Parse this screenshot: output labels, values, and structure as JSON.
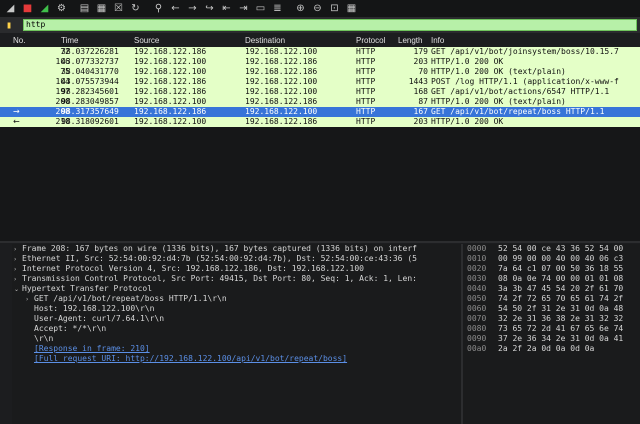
{
  "toolbar": {
    "icons": [
      "shark-fin-icon",
      "stop-capture-icon",
      "restart-capture-icon",
      "capture-options-icon",
      "open-file-icon",
      "save-file-icon",
      "close-file-icon",
      "reload-icon",
      "find-packet-icon",
      "go-back-icon",
      "go-forward-icon",
      "go-to-packet-icon",
      "first-packet-icon",
      "last-packet-icon",
      "autoscroll-icon",
      "colorize-icon",
      "zoom-in-icon",
      "zoom-out-icon",
      "normal-size-icon"
    ]
  },
  "filter": {
    "value": "http"
  },
  "columns": {
    "no": "No.",
    "time": "Time",
    "source": "Source",
    "destination": "Destination",
    "protocol": "Protocol",
    "length": "Length",
    "info": "Info"
  },
  "packets": [
    {
      "no": "72",
      "time": "38.037226281",
      "source": "192.168.122.186",
      "destination": "192.168.122.100",
      "protocol": "HTTP",
      "length": "179",
      "info": "GET /api/v1/bot/joinsystem/boss/10.15.7",
      "mark": ""
    },
    {
      "no": "106",
      "time": "43.077332737",
      "source": "192.168.122.100",
      "destination": "192.168.122.186",
      "protocol": "HTTP",
      "length": "203",
      "info": "HTTP/1.0 200 OK",
      "mark": ""
    },
    {
      "no": "75",
      "time": "38.040431770",
      "source": "192.168.122.100",
      "destination": "192.168.122.186",
      "protocol": "HTTP",
      "length": "70",
      "info": "HTTP/1.0 200 OK  (text/plain)",
      "mark": ""
    },
    {
      "no": "104",
      "time": "43.075573944",
      "source": "192.168.122.186",
      "destination": "192.168.122.100",
      "protocol": "HTTP",
      "length": "1443",
      "info": "POST /log HTTP/1.1  (application/x-www-f",
      "mark": ""
    },
    {
      "no": "197",
      "time": "98.282345601",
      "source": "192.168.122.186",
      "destination": "192.168.122.100",
      "protocol": "HTTP",
      "length": "168",
      "info": "GET /api/v1/bot/actions/6547 HTTP/1.1",
      "mark": ""
    },
    {
      "no": "200",
      "time": "98.283049857",
      "source": "192.168.122.100",
      "destination": "192.168.122.186",
      "protocol": "HTTP",
      "length": "87",
      "info": "HTTP/1.0 200 OK  (text/plain)",
      "mark": ""
    },
    {
      "no": "208",
      "time": "98.317357649",
      "source": "192.168.122.186",
      "destination": "192.168.122.100",
      "protocol": "HTTP",
      "length": "167",
      "info": "GET /api/v1/bot/repeat/boss HTTP/1.1",
      "mark": "→",
      "selected": true
    },
    {
      "no": "210",
      "time": "98.318092601",
      "source": "192.168.122.100",
      "destination": "192.168.122.186",
      "protocol": "HTTP",
      "length": "203",
      "info": "HTTP/1.0 200 OK",
      "mark": "←"
    }
  ],
  "details": [
    {
      "indent": 0,
      "tri": "›",
      "text": "Frame 208: 167 bytes on wire (1336 bits), 167 bytes captured (1336 bits) on interf"
    },
    {
      "indent": 0,
      "tri": "›",
      "text": "Ethernet II, Src: 52:54:00:92:d4:7b (52:54:00:92:d4:7b), Dst: 52:54:00:ce:43:36 (5"
    },
    {
      "indent": 0,
      "tri": "›",
      "text": "Internet Protocol Version 4, Src: 192.168.122.186, Dst: 192.168.122.100"
    },
    {
      "indent": 0,
      "tri": "›",
      "text": "Transmission Control Protocol, Src Port: 49415, Dst Port: 80, Seq: 1, Ack: 1, Len:"
    },
    {
      "indent": 0,
      "tri": "⌄",
      "text": "Hypertext Transfer Protocol"
    },
    {
      "indent": 1,
      "tri": "›",
      "text": "GET /api/v1/bot/repeat/boss HTTP/1.1\\r\\n"
    },
    {
      "indent": 1,
      "tri": "",
      "text": "Host: 192.168.122.100\\r\\n"
    },
    {
      "indent": 1,
      "tri": "",
      "text": "User-Agent: curl/7.64.1\\r\\n"
    },
    {
      "indent": 1,
      "tri": "",
      "text": "Accept: */*\\r\\n"
    },
    {
      "indent": 1,
      "tri": "",
      "text": "\\r\\n"
    },
    {
      "indent": 1,
      "tri": "",
      "text": "[Response in frame: 210]",
      "link": true
    },
    {
      "indent": 1,
      "tri": "",
      "text": "[Full request URI: http://192.168.122.100/api/v1/bot/repeat/boss]",
      "link": true
    }
  ],
  "bytes": [
    {
      "offset": "0000",
      "hex": "52 54 00 ce 43 36 52 54  00"
    },
    {
      "offset": "0010",
      "hex": "00 99 00 00 40 00 40 06  c3"
    },
    {
      "offset": "0020",
      "hex": "7a 64 c1 07 00 50 36 18  55"
    },
    {
      "offset": "0030",
      "hex": "08 0a 0e 74 00 00 01 01  08"
    },
    {
      "offset": "0040",
      "hex": "3a 3b 47 45 54 20 2f 61  70"
    },
    {
      "offset": "0050",
      "hex": "74 2f 72 65 70 65 61 74  2f"
    },
    {
      "offset": "0060",
      "hex": "54 50 2f 31 2e 31 0d 0a  48"
    },
    {
      "offset": "0070",
      "hex": "32 2e 31 36 38 2e 31 32  32"
    },
    {
      "offset": "0080",
      "hex": "73 65 72 2d 41 67 65 6e  74"
    },
    {
      "offset": "0090",
      "hex": "37 2e 36 34 2e 31 0d 0a  41"
    },
    {
      "offset": "00a0",
      "hex": "2a 2f 2a 0d 0a 0d 0a"
    }
  ]
}
